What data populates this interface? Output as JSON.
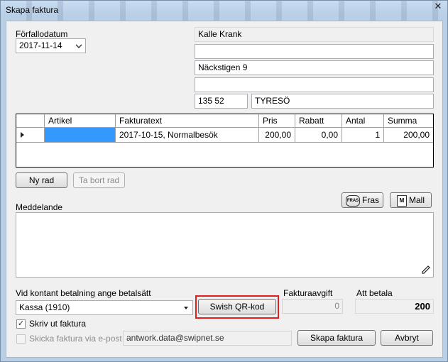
{
  "window": {
    "title": "Skapa faktura",
    "close_glyph": "✕"
  },
  "due_date": {
    "label": "Förfallodatum",
    "value": "2017-11-14"
  },
  "address": {
    "name": "Kalle Krank",
    "line2": "",
    "street": "Näckstigen 9",
    "line4": "",
    "zip": "135 52",
    "city": "TYRESÖ"
  },
  "grid": {
    "columns": [
      "Artikel",
      "Fakturatext",
      "Pris",
      "Rabatt",
      "Antal",
      "Summa"
    ],
    "rows": [
      {
        "artikel": "",
        "fakturatext": "2017-10-15, Normalbesök",
        "pris": "200,00",
        "rabatt": "0,00",
        "antal": "1",
        "summa": "200,00"
      }
    ]
  },
  "buttons": {
    "new_row": "Ny rad",
    "delete_row": "Ta bort rad",
    "fras": "Fras",
    "mall": "Mall",
    "swish": "Swish QR-kod",
    "create": "Skapa faktura",
    "cancel": "Avbryt"
  },
  "icons": {
    "fras_icon_text": "FRAS",
    "mall_icon_text": "M"
  },
  "message": {
    "label": "Meddelande",
    "value": ""
  },
  "payment": {
    "label": "Vid kontant betalning ange betalsätt",
    "value": "Kassa (1910)"
  },
  "fee": {
    "label": "Fakturaavgift",
    "value": "0"
  },
  "to_pay": {
    "label": "Att betala",
    "value": "200"
  },
  "print_invoice": {
    "label": "Skriv ut faktura",
    "checked": true
  },
  "email_invoice": {
    "label": "Skicka faktura via e-post",
    "checked": false,
    "email": "antwork.data@swipnet.se"
  },
  "colors": {
    "selection": "#3399ff",
    "highlight_border": "#e02020"
  }
}
